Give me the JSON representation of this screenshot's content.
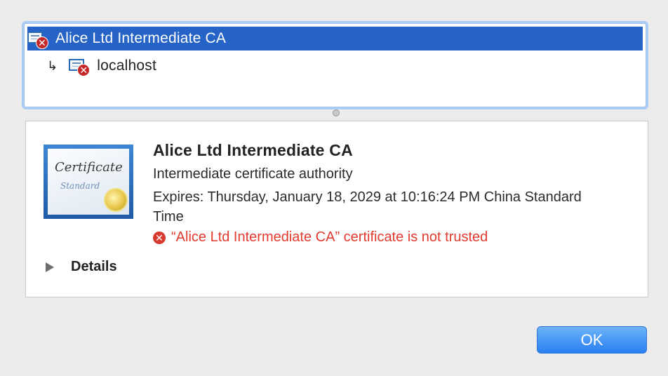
{
  "chain": {
    "items": [
      {
        "label": "Alice Ltd Intermediate CA",
        "selected": true
      },
      {
        "label": "localhost",
        "selected": false,
        "arrow": "↳"
      }
    ]
  },
  "detail": {
    "cert_image": {
      "line1": "Certificate",
      "line2": "Standard"
    },
    "name": "Alice Ltd Intermediate CA",
    "subtitle": "Intermediate certificate authority",
    "expires": "Expires: Thursday, January 18, 2029 at 10:16:24 PM China Standard Time",
    "warning": "“Alice Ltd Intermediate CA” certificate is not trusted",
    "warning_icon": "✕",
    "details_label": "Details"
  },
  "buttons": {
    "ok_label": "OK"
  },
  "colors": {
    "selection": "#2563c7",
    "error": "#e23a2e",
    "button": "#2a7ff0"
  }
}
